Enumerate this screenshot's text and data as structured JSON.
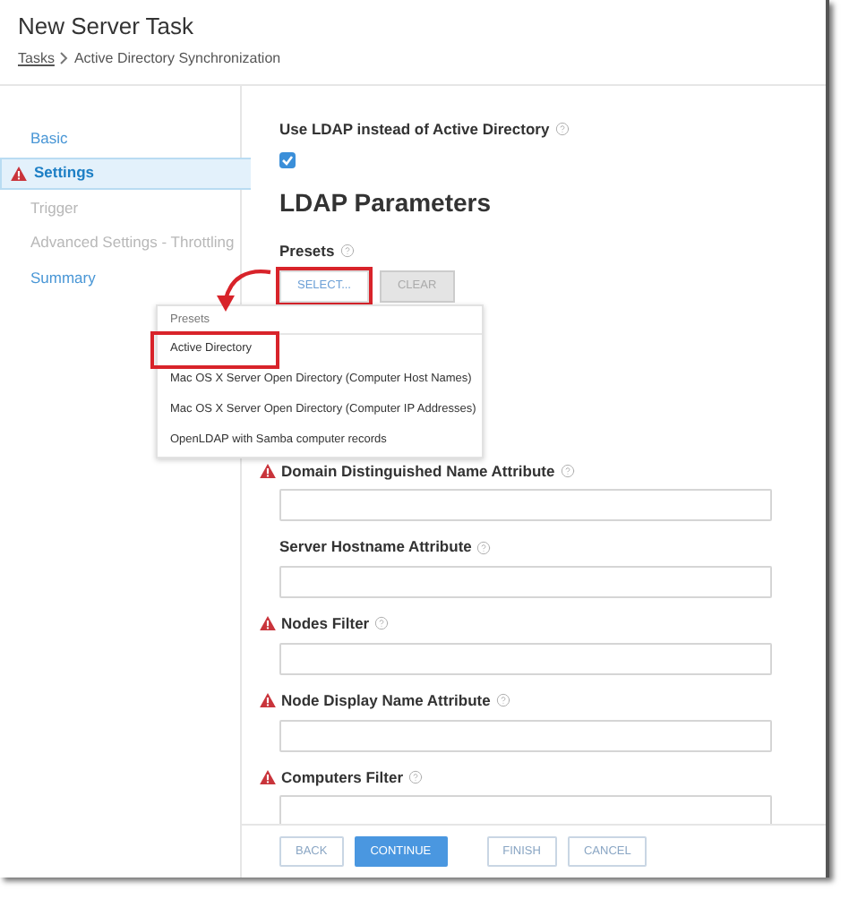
{
  "window": {
    "title": "New Server Task"
  },
  "breadcrumb": [
    {
      "label": "Tasks",
      "link": true
    },
    {
      "label": "Active Directory Synchronization",
      "link": false
    }
  ],
  "sidebar": {
    "items": [
      {
        "label": "Basic",
        "selected": false,
        "disabled": false,
        "warning": false
      },
      {
        "label": "Settings",
        "selected": true,
        "disabled": false,
        "warning": true
      },
      {
        "label": "Trigger",
        "selected": false,
        "disabled": true,
        "warning": false
      },
      {
        "label": "Advanced Settings - Throttling",
        "selected": false,
        "disabled": true,
        "warning": false
      },
      {
        "label": "Summary",
        "selected": false,
        "disabled": false,
        "warning": false
      }
    ]
  },
  "use_ldap": {
    "label": "Use LDAP instead of Active Directory",
    "checked": true
  },
  "section_title": "LDAP Parameters",
  "presets": {
    "label": "Presets",
    "select_button": {
      "label": "SELECT...",
      "highlighted": true
    },
    "clear_button": {
      "label": "CLEAR",
      "disabled": true
    }
  },
  "presets_menu": {
    "header": "Presets",
    "items": [
      {
        "label": "Active Directory",
        "highlighted": true
      },
      {
        "label": "Mac OS X Server Open Directory (Computer Host Names)",
        "highlighted": false
      },
      {
        "label": "Mac OS X Server Open Directory (Computer IP Addresses)",
        "highlighted": false
      },
      {
        "label": "OpenLDAP with Samba computer records",
        "highlighted": false
      }
    ]
  },
  "fields": [
    {
      "label": "Domain Distinguished Name Attribute",
      "warning": true
    },
    {
      "label": "Server Hostname Attribute",
      "warning": false
    },
    {
      "label": "Nodes Filter",
      "warning": true
    },
    {
      "label": "Node Display Name Attribute",
      "warning": true
    },
    {
      "label": "Computers Filter",
      "warning": true
    }
  ],
  "footer_buttons": [
    {
      "label": "BACK",
      "primary": false
    },
    {
      "label": "CONTINUE",
      "primary": true
    },
    {
      "label": "FINISH",
      "primary": false
    },
    {
      "label": "CANCEL",
      "primary": false
    }
  ]
}
